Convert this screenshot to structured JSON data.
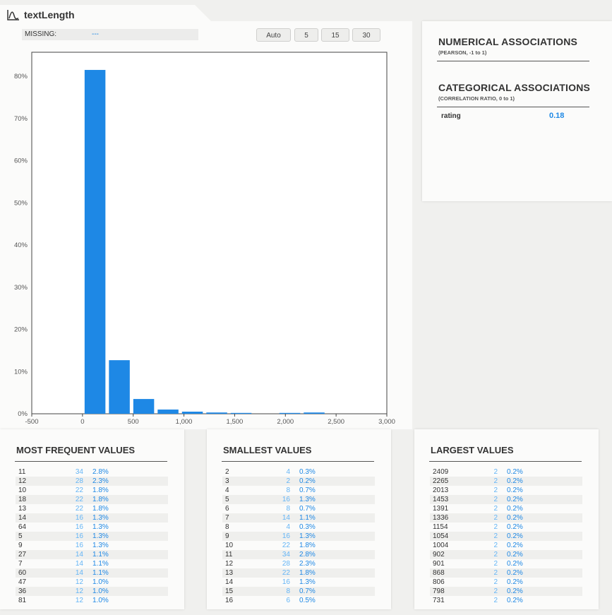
{
  "variable": {
    "name": "textLength",
    "icon": "distribution-icon"
  },
  "missing": {
    "label": "MISSING:",
    "value": "---"
  },
  "bin_buttons": [
    "Auto",
    "5",
    "15",
    "30"
  ],
  "chart_data": {
    "type": "bar",
    "title": "",
    "xlabel": "",
    "ylabel": "",
    "xlim": [
      -500,
      3000
    ],
    "ylim": [
      0,
      0.85
    ],
    "x_ticks": [
      -500,
      0,
      500,
      1000,
      1500,
      2000,
      2500,
      3000
    ],
    "x_tick_labels": [
      "-500",
      "0",
      "500",
      "1,000",
      "1,500",
      "2,000",
      "2,500",
      "3,000"
    ],
    "y_ticks": [
      0,
      0.1,
      0.2,
      0.3,
      0.4,
      0.5,
      0.6,
      0.7,
      0.8
    ],
    "y_tick_labels": [
      "0%",
      "10%",
      "20%",
      "30%",
      "40%",
      "50%",
      "60%",
      "70%",
      "80%"
    ],
    "bins": [
      {
        "start": 0,
        "end": 240,
        "value": 0.815
      },
      {
        "start": 240,
        "end": 480,
        "value": 0.127
      },
      {
        "start": 480,
        "end": 720,
        "value": 0.035
      },
      {
        "start": 720,
        "end": 960,
        "value": 0.01
      },
      {
        "start": 960,
        "end": 1200,
        "value": 0.005
      },
      {
        "start": 1200,
        "end": 1440,
        "value": 0.003
      },
      {
        "start": 1440,
        "end": 1680,
        "value": 0.002
      },
      {
        "start": 1680,
        "end": 1920,
        "value": 0.0
      },
      {
        "start": 1920,
        "end": 2160,
        "value": 0.002
      },
      {
        "start": 2160,
        "end": 2400,
        "value": 0.003
      }
    ],
    "color": "#1e88e5",
    "grid": false
  },
  "numerical_associations": {
    "title": "NUMERICAL ASSOCIATIONS",
    "subtitle": "(PEARSON, -1 to 1)"
  },
  "categorical_associations": {
    "title": "CATEGORICAL ASSOCIATIONS",
    "subtitle": "(CORRELATION RATIO, 0 to 1)",
    "rows": [
      {
        "name": "rating",
        "value": "0.18"
      }
    ]
  },
  "most_frequent": {
    "title": "MOST FREQUENT VALUES",
    "rows": [
      [
        "11",
        "34",
        "2.8%"
      ],
      [
        "12",
        "28",
        "2.3%"
      ],
      [
        "10",
        "22",
        "1.8%"
      ],
      [
        "18",
        "22",
        "1.8%"
      ],
      [
        "13",
        "22",
        "1.8%"
      ],
      [
        "14",
        "16",
        "1.3%"
      ],
      [
        "64",
        "16",
        "1.3%"
      ],
      [
        "5",
        "16",
        "1.3%"
      ],
      [
        "9",
        "16",
        "1.3%"
      ],
      [
        "27",
        "14",
        "1.1%"
      ],
      [
        "7",
        "14",
        "1.1%"
      ],
      [
        "60",
        "14",
        "1.1%"
      ],
      [
        "47",
        "12",
        "1.0%"
      ],
      [
        "36",
        "12",
        "1.0%"
      ],
      [
        "81",
        "12",
        "1.0%"
      ]
    ]
  },
  "smallest": {
    "title": "SMALLEST VALUES",
    "rows": [
      [
        "2",
        "4",
        "0.3%"
      ],
      [
        "3",
        "2",
        "0.2%"
      ],
      [
        "4",
        "8",
        "0.7%"
      ],
      [
        "5",
        "16",
        "1.3%"
      ],
      [
        "6",
        "8",
        "0.7%"
      ],
      [
        "7",
        "14",
        "1.1%"
      ],
      [
        "8",
        "4",
        "0.3%"
      ],
      [
        "9",
        "16",
        "1.3%"
      ],
      [
        "10",
        "22",
        "1.8%"
      ],
      [
        "11",
        "34",
        "2.8%"
      ],
      [
        "12",
        "28",
        "2.3%"
      ],
      [
        "13",
        "22",
        "1.8%"
      ],
      [
        "14",
        "16",
        "1.3%"
      ],
      [
        "15",
        "8",
        "0.7%"
      ],
      [
        "16",
        "6",
        "0.5%"
      ]
    ]
  },
  "largest": {
    "title": "LARGEST VALUES",
    "rows": [
      [
        "2409",
        "2",
        "0.2%"
      ],
      [
        "2265",
        "2",
        "0.2%"
      ],
      [
        "2013",
        "2",
        "0.2%"
      ],
      [
        "1453",
        "2",
        "0.2%"
      ],
      [
        "1391",
        "2",
        "0.2%"
      ],
      [
        "1336",
        "2",
        "0.2%"
      ],
      [
        "1154",
        "2",
        "0.2%"
      ],
      [
        "1054",
        "2",
        "0.2%"
      ],
      [
        "1004",
        "2",
        "0.2%"
      ],
      [
        "902",
        "2",
        "0.2%"
      ],
      [
        "901",
        "2",
        "0.2%"
      ],
      [
        "868",
        "2",
        "0.2%"
      ],
      [
        "806",
        "2",
        "0.2%"
      ],
      [
        "798",
        "2",
        "0.2%"
      ],
      [
        "731",
        "2",
        "0.2%"
      ]
    ]
  }
}
